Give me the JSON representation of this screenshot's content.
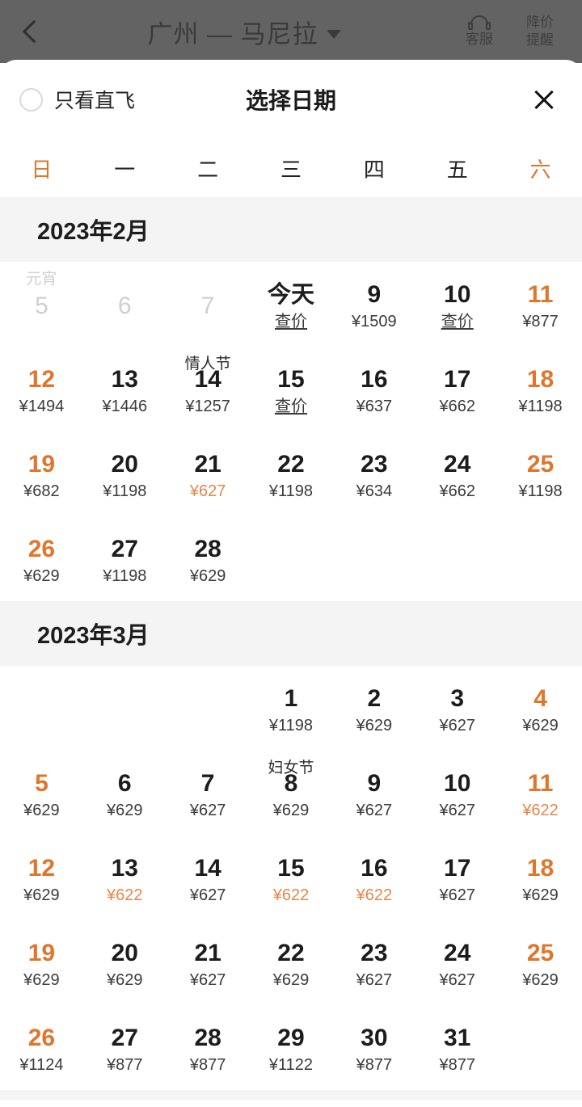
{
  "header": {
    "back_icon": "back-chevron-icon",
    "route_title": "广州 — 马尼拉",
    "route_caret_icon": "chevron-down-icon",
    "support": {
      "icon": "headset-icon",
      "label": "客服"
    },
    "price_alert": {
      "line1": "降价",
      "line2": "提醒"
    }
  },
  "sheet": {
    "direct_only_label": "只看直飞",
    "direct_only_checked": false,
    "title": "选择日期",
    "close_icon": "close-icon"
  },
  "weekdays": [
    {
      "label": "日",
      "accent": true
    },
    {
      "label": "一",
      "accent": false
    },
    {
      "label": "二",
      "accent": false
    },
    {
      "label": "三",
      "accent": false
    },
    {
      "label": "四",
      "accent": false
    },
    {
      "label": "五",
      "accent": false
    },
    {
      "label": "六",
      "accent": true
    }
  ],
  "colors": {
    "accent": "#e0762c",
    "low_price": "#e8854a",
    "day_text": "#1c1c1c",
    "price_text": "#3b3b3b",
    "disabled": "#cfcfcf",
    "month_band_bg": "#f4f4f4",
    "header_dim_bg": "#636363"
  },
  "months": [
    {
      "label": "2023年2月",
      "weeks": [
        [
          {
            "day": "5",
            "price": "",
            "festival": "元宵",
            "state": "disabled"
          },
          {
            "day": "6",
            "price": "",
            "festival": "",
            "state": "disabled"
          },
          {
            "day": "7",
            "price": "",
            "festival": "",
            "state": "disabled"
          },
          {
            "day": "今天",
            "price": "查价",
            "festival": "",
            "state": "today"
          },
          {
            "day": "9",
            "price": "¥1509",
            "festival": "",
            "state": "normal"
          },
          {
            "day": "10",
            "price": "查价",
            "festival": "",
            "state": "normal"
          },
          {
            "day": "11",
            "price": "¥877",
            "festival": "",
            "state": "weekend"
          }
        ],
        [
          {
            "day": "12",
            "price": "¥1494",
            "festival": "",
            "state": "weekend"
          },
          {
            "day": "13",
            "price": "¥1446",
            "festival": "",
            "state": "normal"
          },
          {
            "day": "14",
            "price": "¥1257",
            "festival": "情人节",
            "state": "normal"
          },
          {
            "day": "15",
            "price": "查价",
            "festival": "",
            "state": "normal"
          },
          {
            "day": "16",
            "price": "¥637",
            "festival": "",
            "state": "normal"
          },
          {
            "day": "17",
            "price": "¥662",
            "festival": "",
            "state": "normal"
          },
          {
            "day": "18",
            "price": "¥1198",
            "festival": "",
            "state": "weekend"
          }
        ],
        [
          {
            "day": "19",
            "price": "¥682",
            "festival": "",
            "state": "weekend"
          },
          {
            "day": "20",
            "price": "¥1198",
            "festival": "",
            "state": "normal"
          },
          {
            "day": "21",
            "price": "¥627",
            "festival": "",
            "state": "normal",
            "price_low": true
          },
          {
            "day": "22",
            "price": "¥1198",
            "festival": "",
            "state": "normal"
          },
          {
            "day": "23",
            "price": "¥634",
            "festival": "",
            "state": "normal"
          },
          {
            "day": "24",
            "price": "¥662",
            "festival": "",
            "state": "normal"
          },
          {
            "day": "25",
            "price": "¥1198",
            "festival": "",
            "state": "weekend"
          }
        ],
        [
          {
            "day": "26",
            "price": "¥629",
            "festival": "",
            "state": "weekend"
          },
          {
            "day": "27",
            "price": "¥1198",
            "festival": "",
            "state": "normal"
          },
          {
            "day": "28",
            "price": "¥629",
            "festival": "",
            "state": "normal"
          },
          {
            "day": "",
            "price": "",
            "festival": "",
            "state": "empty"
          },
          {
            "day": "",
            "price": "",
            "festival": "",
            "state": "empty"
          },
          {
            "day": "",
            "price": "",
            "festival": "",
            "state": "empty"
          },
          {
            "day": "",
            "price": "",
            "festival": "",
            "state": "empty"
          }
        ]
      ]
    },
    {
      "label": "2023年3月",
      "weeks": [
        [
          {
            "day": "",
            "price": "",
            "festival": "",
            "state": "empty"
          },
          {
            "day": "",
            "price": "",
            "festival": "",
            "state": "empty"
          },
          {
            "day": "",
            "price": "",
            "festival": "",
            "state": "empty"
          },
          {
            "day": "1",
            "price": "¥1198",
            "festival": "",
            "state": "normal"
          },
          {
            "day": "2",
            "price": "¥629",
            "festival": "",
            "state": "normal"
          },
          {
            "day": "3",
            "price": "¥627",
            "festival": "",
            "state": "normal"
          },
          {
            "day": "4",
            "price": "¥629",
            "festival": "",
            "state": "weekend"
          }
        ],
        [
          {
            "day": "5",
            "price": "¥629",
            "festival": "",
            "state": "weekend"
          },
          {
            "day": "6",
            "price": "¥629",
            "festival": "",
            "state": "normal"
          },
          {
            "day": "7",
            "price": "¥627",
            "festival": "",
            "state": "normal"
          },
          {
            "day": "8",
            "price": "¥629",
            "festival": "妇女节",
            "state": "normal"
          },
          {
            "day": "9",
            "price": "¥627",
            "festival": "",
            "state": "normal"
          },
          {
            "day": "10",
            "price": "¥627",
            "festival": "",
            "state": "normal"
          },
          {
            "day": "11",
            "price": "¥622",
            "festival": "",
            "state": "weekend",
            "price_low": true
          }
        ],
        [
          {
            "day": "12",
            "price": "¥629",
            "festival": "",
            "state": "weekend"
          },
          {
            "day": "13",
            "price": "¥622",
            "festival": "",
            "state": "normal",
            "price_low": true
          },
          {
            "day": "14",
            "price": "¥627",
            "festival": "",
            "state": "normal"
          },
          {
            "day": "15",
            "price": "¥622",
            "festival": "",
            "state": "normal",
            "price_low": true
          },
          {
            "day": "16",
            "price": "¥622",
            "festival": "",
            "state": "normal",
            "price_low": true
          },
          {
            "day": "17",
            "price": "¥627",
            "festival": "",
            "state": "normal"
          },
          {
            "day": "18",
            "price": "¥629",
            "festival": "",
            "state": "weekend"
          }
        ],
        [
          {
            "day": "19",
            "price": "¥629",
            "festival": "",
            "state": "weekend"
          },
          {
            "day": "20",
            "price": "¥629",
            "festival": "",
            "state": "normal"
          },
          {
            "day": "21",
            "price": "¥627",
            "festival": "",
            "state": "normal"
          },
          {
            "day": "22",
            "price": "¥629",
            "festival": "",
            "state": "normal"
          },
          {
            "day": "23",
            "price": "¥627",
            "festival": "",
            "state": "normal"
          },
          {
            "day": "24",
            "price": "¥627",
            "festival": "",
            "state": "normal"
          },
          {
            "day": "25",
            "price": "¥629",
            "festival": "",
            "state": "weekend"
          }
        ],
        [
          {
            "day": "26",
            "price": "¥1124",
            "festival": "",
            "state": "weekend"
          },
          {
            "day": "27",
            "price": "¥877",
            "festival": "",
            "state": "normal"
          },
          {
            "day": "28",
            "price": "¥877",
            "festival": "",
            "state": "normal"
          },
          {
            "day": "29",
            "price": "¥1122",
            "festival": "",
            "state": "normal"
          },
          {
            "day": "30",
            "price": "¥877",
            "festival": "",
            "state": "normal"
          },
          {
            "day": "31",
            "price": "¥877",
            "festival": "",
            "state": "normal"
          },
          {
            "day": "",
            "price": "",
            "festival": "",
            "state": "empty"
          }
        ]
      ]
    }
  ]
}
